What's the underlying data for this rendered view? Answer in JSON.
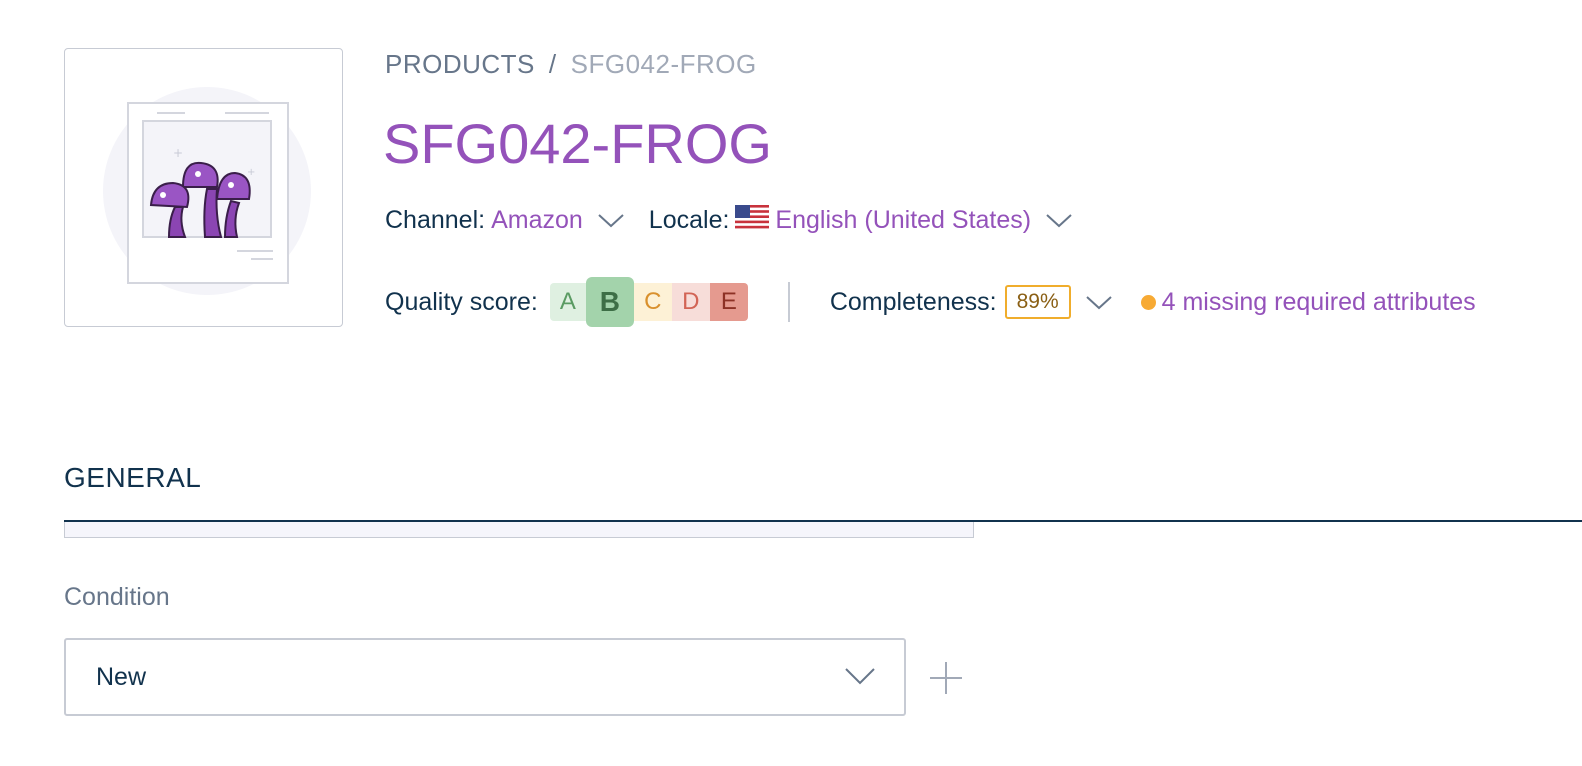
{
  "breadcrumb": {
    "root": "PRODUCTS",
    "separator": "/",
    "current": "SFG042-FROG"
  },
  "product": {
    "title": "SFG042-FROG"
  },
  "context": {
    "channel_label": "Channel:",
    "channel_value": "Amazon",
    "locale_label": "Locale:",
    "locale_value": "English (United States)",
    "locale_flag": "us-flag-icon"
  },
  "quality": {
    "label": "Quality score:",
    "grades": [
      "A",
      "B",
      "C",
      "D",
      "E"
    ],
    "current_grade": "B"
  },
  "completeness": {
    "label": "Completeness:",
    "value": "89%",
    "missing_text": "4 missing required attributes"
  },
  "section": {
    "title": "GENERAL"
  },
  "fields": {
    "condition": {
      "label": "Condition",
      "value": "New"
    }
  },
  "colors": {
    "accent": "#9452ba",
    "text": "#11324d",
    "muted": "#67768a",
    "warning": "#f7aa34"
  }
}
